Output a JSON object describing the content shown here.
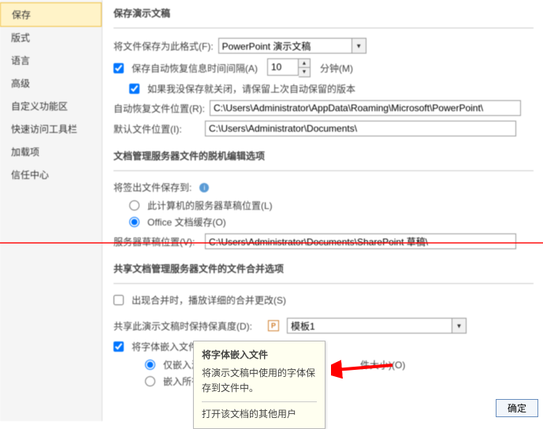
{
  "sidebar": {
    "items": [
      {
        "label": "保存"
      },
      {
        "label": "版式"
      },
      {
        "label": "语言"
      },
      {
        "label": "高级"
      },
      {
        "label": "自定义功能区"
      },
      {
        "label": "快速访问工具栏"
      },
      {
        "label": "加载项"
      },
      {
        "label": "信任中心"
      }
    ]
  },
  "section1": {
    "title": "保存演示文稿",
    "save_format_label": "将文件保存为此格式(F):",
    "save_format_value": "PowerPoint 演示文稿",
    "autorecover_cb": "保存自动恢复信息时间间隔(A)",
    "autorecover_value": "10",
    "autorecover_unit": "分钟(M)",
    "keep_last_label": "如果我没保存就关闭，请保留上次自动保留的版本",
    "auto_loc_label": "自动恢复文件位置(R):",
    "auto_loc_value": "C:\\Users\\Administrator\\AppData\\Roaming\\Microsoft\\PowerPoint\\",
    "default_loc_label": "默认文件位置(I):",
    "default_loc_value": "C:\\Users\\Administrator\\Documents\\"
  },
  "section2": {
    "title": "文档管理服务器文件的脱机编辑选项",
    "saveout_label": "将签出文件保存到:",
    "radio1": "此计算机的服务器草稿位置(L)",
    "radio2": "Office 文档缓存(O)",
    "server_loc_label": "服务器草稿位置(V):",
    "server_loc_value": "C:\\Users\\Administrator\\Documents\\SharePoint 草稿\\"
  },
  "section3": {
    "title": "共享文档管理服务器文件的文件合并选项",
    "merge_cb": "出现合并时，播放详细的合并更改(S)",
    "preserve_label": "共享此演示文稿时保持保真度(D):",
    "preset_value": "模板1",
    "preset_icon": "P",
    "embed_cb": "将字体嵌入文件(E)",
    "embed_r1": "仅嵌入演示文…",
    "embed_r1_tail": "件大小)(O)",
    "embed_r2": "嵌入所有字符"
  },
  "tooltip": {
    "title": "将字体嵌入文件",
    "line1": "将演示文稿中使用的字体保存到文件中。",
    "line2": "打开该文档的其他用户"
  },
  "ok_label": "确定",
  "info_icon": "i"
}
